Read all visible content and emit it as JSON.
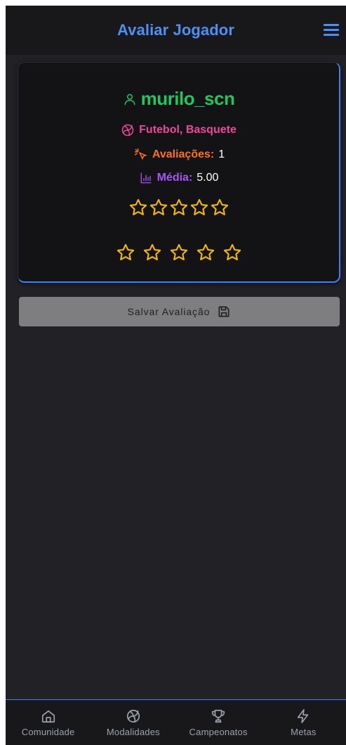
{
  "header": {
    "title": "Avaliar Jogador"
  },
  "player": {
    "username": "murilo_scn",
    "sports": "Futebol, Basquete",
    "avaliacoes_label": "Avaliações:",
    "avaliacoes_value": "1",
    "media_label": "Média:",
    "media_value": "5.00",
    "current_rating_stars": 0,
    "max_stars": 5
  },
  "rating_input": {
    "selected": 0,
    "max": 5
  },
  "save_button": {
    "label": "Salvar Avaliação"
  },
  "bottom_nav": {
    "items": [
      {
        "label": "Comunidade",
        "icon": "home-icon"
      },
      {
        "label": "Modalidades",
        "icon": "volleyball-icon"
      },
      {
        "label": "Campeonatos",
        "icon": "trophy-icon"
      },
      {
        "label": "Metas",
        "icon": "lightning-icon"
      }
    ]
  },
  "colors": {
    "accent": "#4d8ff3",
    "username": "#22c55e",
    "sports": "#ec4899",
    "avaliacoes": "#f97316",
    "media": "#a855f7",
    "star": "#f5b800"
  }
}
